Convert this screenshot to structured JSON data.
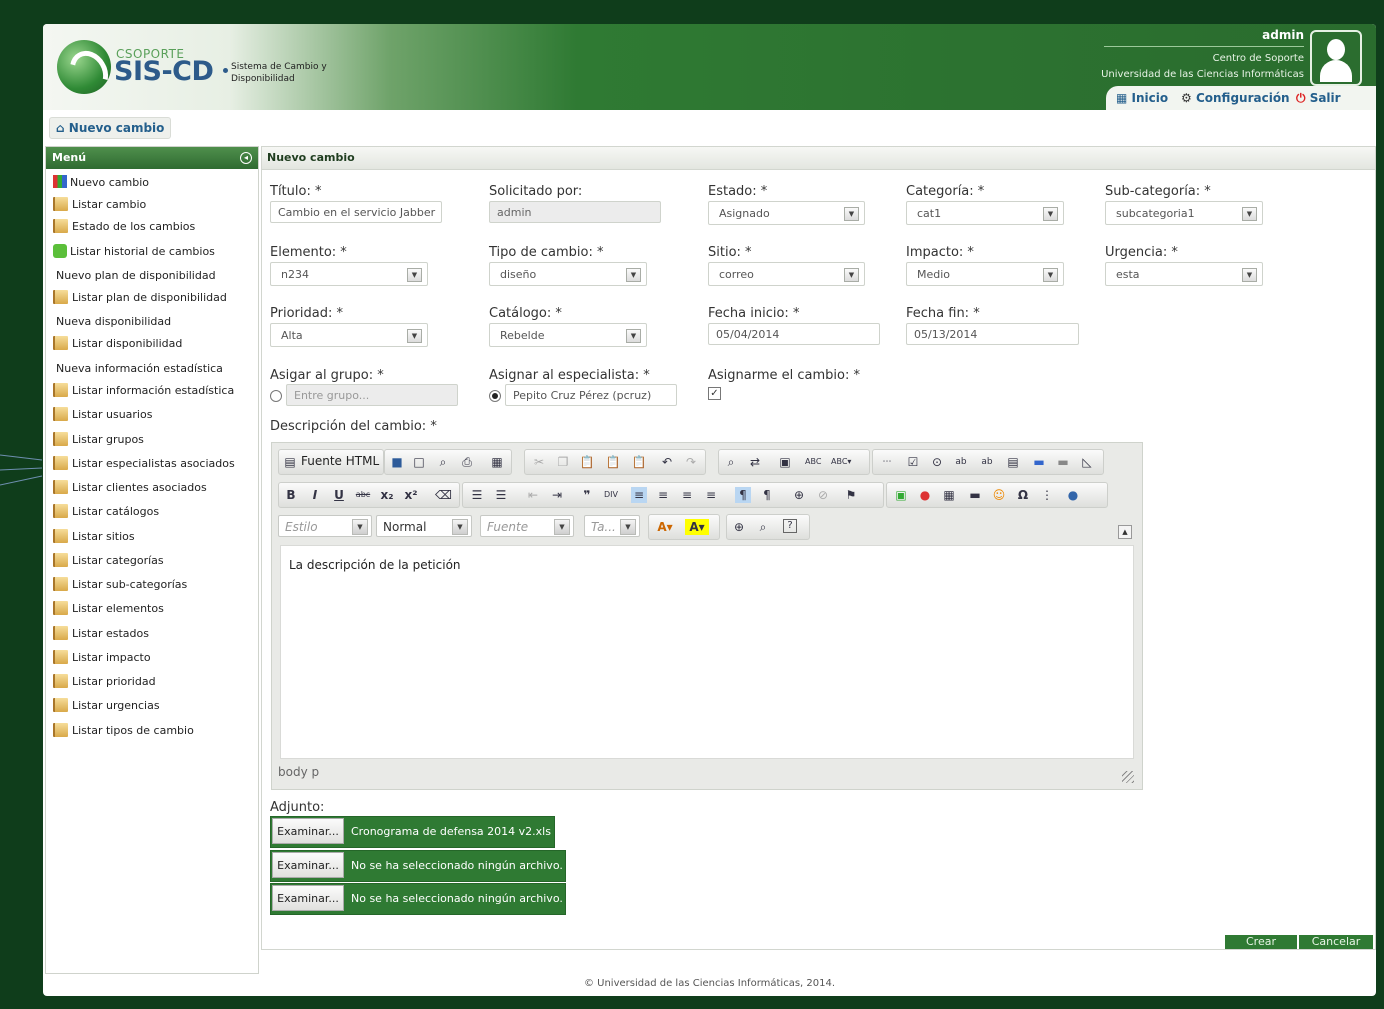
{
  "app": {
    "brand_top": "CSOPORTE",
    "brand_name": "SIS-CD",
    "brand_subtitle": "Sistema de Cambio y Disponibilidad"
  },
  "user": {
    "name": "admin",
    "department": "Centro de Soporte",
    "organization": "Universidad de las Ciencias Informáticas"
  },
  "nav": {
    "home": "Inicio",
    "settings": "Configuración",
    "logout": "Salir"
  },
  "breadcrumb": "Nuevo cambio",
  "sidebar": {
    "title": "Menú",
    "items": [
      "Nuevo cambio",
      "Listar cambio",
      "Estado de los cambios",
      "Listar historial de cambios",
      "Nuevo plan de disponibilidad",
      "Listar plan de disponibilidad",
      "Nueva disponibilidad",
      "Listar disponibilidad",
      "Nueva información estadística",
      "Listar información estadística",
      "Listar usuarios",
      "Listar grupos",
      "Listar especialistas asociados",
      "Listar clientes asociados",
      "Listar catálogos",
      "Listar sitios",
      "Listar categorías",
      "Listar sub-categorías",
      "Listar elementos",
      "Listar estados",
      "Listar impacto",
      "Listar prioridad",
      "Listar urgencias",
      "Listar tipos de cambio"
    ]
  },
  "form": {
    "panel_title": "Nuevo cambio",
    "titulo": {
      "label": "Título: *",
      "value": "Cambio en el servicio Jabber"
    },
    "solicitado": {
      "label": "Solicitado por:",
      "value": "admin"
    },
    "estado": {
      "label": "Estado: *",
      "value": "Asignado"
    },
    "categoria": {
      "label": "Categoría: *",
      "value": "cat1"
    },
    "subcategoria": {
      "label": "Sub-categoría: *",
      "value": "subcategoria1"
    },
    "elemento": {
      "label": "Elemento: *",
      "value": "n234"
    },
    "tipo": {
      "label": "Tipo de cambio: *",
      "value": "diseño"
    },
    "sitio": {
      "label": "Sitio: *",
      "value": "correo"
    },
    "impacto": {
      "label": "Impacto: *",
      "value": "Medio"
    },
    "urgencia": {
      "label": "Urgencia: *",
      "value": "esta"
    },
    "prioridad": {
      "label": "Prioridad: *",
      "value": "Alta"
    },
    "catalogo": {
      "label": "Catálogo: *",
      "value": "Rebelde"
    },
    "fecha_inicio": {
      "label": "Fecha inicio: *",
      "value": "05/04/2014"
    },
    "fecha_fin": {
      "label": "Fecha fin: *",
      "value": "05/13/2014"
    },
    "grupo": {
      "label": "Asigar al grupo: *",
      "placeholder": "Entre grupo..."
    },
    "especialista": {
      "label": "Asignar al especialista: *",
      "value": "Pepito Cruz Pérez (pcruz)"
    },
    "asignarme": {
      "label": "Asignarme el cambio: *",
      "checked": true
    },
    "descripcion": {
      "label": "Descripción del cambio: *",
      "text": "La descripción de la petición"
    },
    "adjunto": {
      "label": "Adjunto:",
      "browse_label": "Examinar...",
      "files": [
        "Cronograma de defensa 2014 v2.xls",
        "No se ha seleccionado ningún archivo.",
        "No se ha seleccionado ningún archivo."
      ]
    },
    "crear": "Crear",
    "cancelar": "Cancelar"
  },
  "editor": {
    "source_label": "Fuente HTML",
    "style_combo": "Estilo",
    "format_combo": "Normal",
    "font_combo": "Fuente",
    "size_combo": "Ta...",
    "path": "body  p"
  },
  "footer": "© Universidad de las Ciencias Informáticas, 2014."
}
